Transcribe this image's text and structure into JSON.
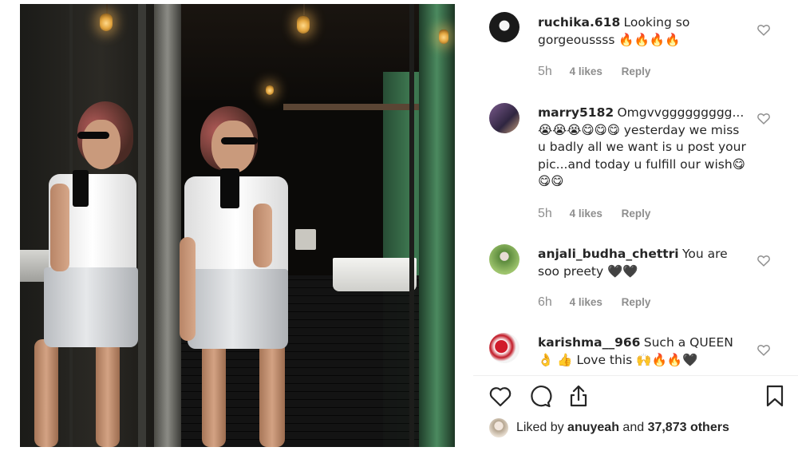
{
  "comments": [
    {
      "username": "ruchika.618",
      "text": "Looking so gorgeoussss 🔥🔥🔥🔥",
      "time": "5h",
      "likes": "4 likes",
      "reply": "Reply"
    },
    {
      "username": "marry5182",
      "text": "Omgvvggggggggg... 😭😭😭😋😋😋 yesterday we miss u badly all we want is u post your pic...and today u fulfill our wish😋😋😋",
      "time": "5h",
      "likes": "4 likes",
      "reply": "Reply"
    },
    {
      "username": "anjali_budha_chettri",
      "text": "You are soo preety 🖤🖤",
      "time": "6h",
      "likes": "4 likes",
      "reply": "Reply"
    },
    {
      "username": "karishma__966",
      "text": "Such a QUEEN 👌 👍 Love this 🙌🔥🔥🖤",
      "time": "",
      "likes": "",
      "reply": ""
    }
  ],
  "actions": {
    "like_icon": "heart-icon",
    "comment_icon": "comment-bubble-icon",
    "share_icon": "share-icon",
    "save_icon": "bookmark-icon"
  },
  "liked_by": {
    "prefix": "Liked by ",
    "user": "anuyeah",
    "middle": " and ",
    "others": "37,873 others"
  }
}
